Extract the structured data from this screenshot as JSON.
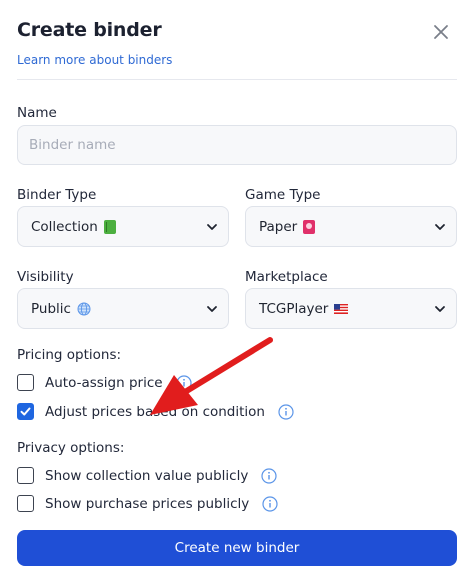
{
  "dialog": {
    "title": "Create binder",
    "learn_more": "Learn more about binders"
  },
  "name_field": {
    "label": "Name",
    "placeholder": "Binder name",
    "value": ""
  },
  "binder_type": {
    "label": "Binder Type",
    "selected": "Collection",
    "icon": "green-book-emoji"
  },
  "game_type": {
    "label": "Game Type",
    "selected": "Paper",
    "icon": "pink-card-emoji"
  },
  "visibility": {
    "label": "Visibility",
    "selected": "Public",
    "icon": "globe-icon"
  },
  "marketplace": {
    "label": "Marketplace",
    "selected": "TCGPlayer",
    "icon": "us-flag-icon"
  },
  "pricing": {
    "heading": "Pricing options:",
    "auto_assign": {
      "label": "Auto-assign price",
      "checked": false
    },
    "adjust_condition": {
      "label": "Adjust prices based on condition",
      "checked": true
    }
  },
  "privacy": {
    "heading": "Privacy options:",
    "show_collection_value": {
      "label": "Show collection value publicly",
      "checked": false
    },
    "show_purchase_prices": {
      "label": "Show purchase prices publicly",
      "checked": false
    }
  },
  "submit": {
    "label": "Create new binder"
  },
  "colors": {
    "primary": "#1f4fd6",
    "link": "#2f6ad4",
    "checkbox_checked": "#1f66e0",
    "info_icon": "#5b95e8",
    "annotation_arrow": "#e11d1d"
  }
}
